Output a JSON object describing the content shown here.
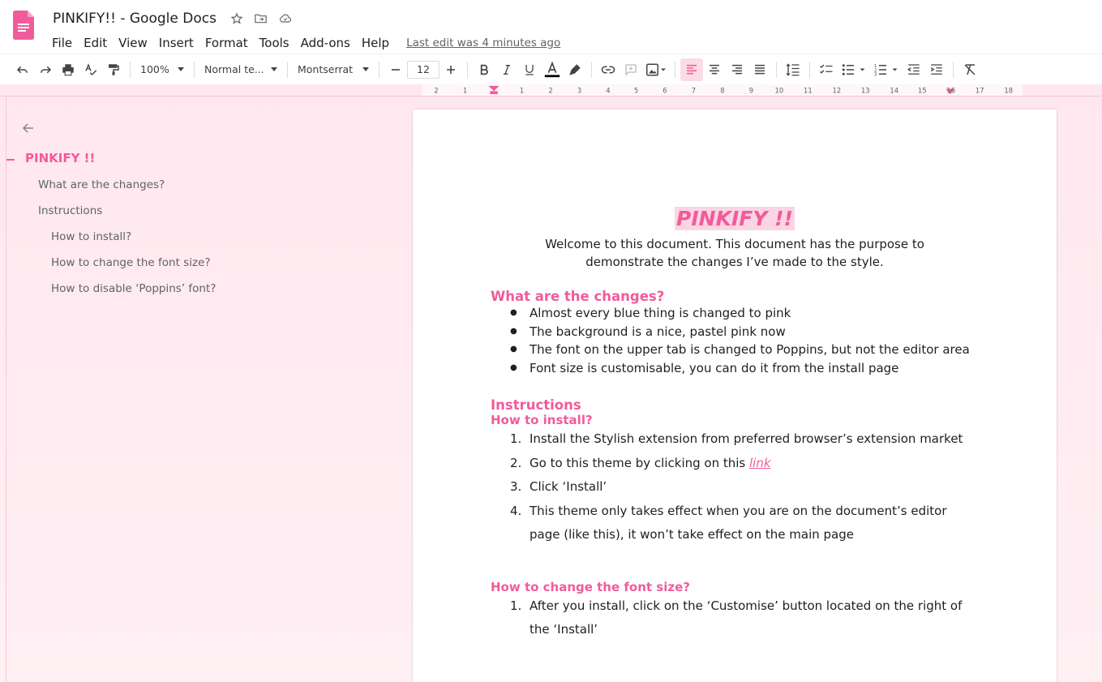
{
  "colors": {
    "accent": "#f15b9b",
    "workspace_bg": "#ffe7ef",
    "highlight": "#fbd5e3"
  },
  "header": {
    "title": "PINKIFY!! - Google Docs",
    "menus": [
      "File",
      "Edit",
      "View",
      "Insert",
      "Format",
      "Tools",
      "Add-ons",
      "Help"
    ],
    "last_edit": "Last edit was 4 minutes ago"
  },
  "toolbar": {
    "zoom": "100%",
    "style": "Normal te...",
    "font": "Montserrat",
    "font_size": "12"
  },
  "ruler": {
    "marks": [
      "2",
      "1",
      "1",
      "2",
      "3",
      "4",
      "5",
      "6",
      "7",
      "8",
      "9",
      "10",
      "11",
      "12",
      "13",
      "14",
      "15",
      "16",
      "17",
      "18"
    ]
  },
  "outline": {
    "title": "PINKIFY !!",
    "items": [
      {
        "label": "What are the changes?",
        "level": 2
      },
      {
        "label": "Instructions",
        "level": 2
      },
      {
        "label": "How to install?",
        "level": 3
      },
      {
        "label": "How to change the font size?",
        "level": 3
      },
      {
        "label": "How to disable ‘Poppins’ font?",
        "level": 3
      }
    ]
  },
  "document": {
    "title": "PINKIFY !!",
    "intro": "Welcome to this document. This document has the purpose to demonstrate the changes I’ve made to the style.",
    "changes_heading": "What are the changes?",
    "changes": [
      "Almost every blue thing is changed to pink",
      "The background is a nice, pastel pink now",
      "The font on the upper tab is changed to Poppins, but not the editor area",
      "Font size is customisable, you can do it from the install page"
    ],
    "instructions_heading": "Instructions",
    "install_heading": "How to install?",
    "install_steps": {
      "s1": "Install the Stylish extension from preferred browser’s extension market",
      "s2_prefix": "Go to this theme by clicking on this ",
      "s2_link": "link",
      "s3": "Click ‘Install’",
      "s4": "This theme only takes effect when you are on the document’s editor page (like this), it won’t take effect on the main page"
    },
    "font_size_heading": "How to change the font size?",
    "font_size_steps": [
      "After you install, click on the ‘Customise’ button located on the right of the ‘Install’"
    ]
  }
}
